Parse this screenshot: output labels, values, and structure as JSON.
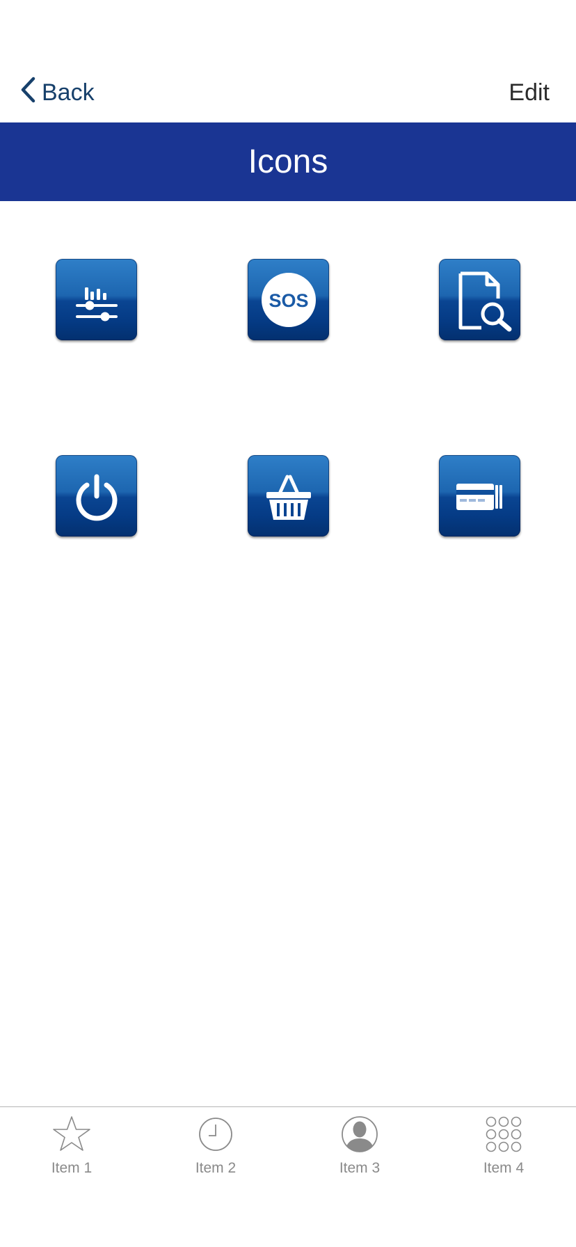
{
  "navbar": {
    "back_label": "Back",
    "edit_label": "Edit"
  },
  "header": {
    "title": "Icons"
  },
  "grid": {
    "icons": [
      {
        "name": "equalizer-icon"
      },
      {
        "name": "sos-icon",
        "text": "SOS"
      },
      {
        "name": "document-search-icon"
      },
      {
        "name": "power-icon"
      },
      {
        "name": "basket-icon"
      },
      {
        "name": "credit-card-icon"
      }
    ]
  },
  "tabbar": {
    "items": [
      {
        "label": "Item 1",
        "icon": "star-icon"
      },
      {
        "label": "Item 2",
        "icon": "clock-icon"
      },
      {
        "label": "Item 3",
        "icon": "person-icon"
      },
      {
        "label": "Item 4",
        "icon": "grid-dots-icon"
      }
    ]
  },
  "colors": {
    "title_bar": "#1a3593",
    "back_text": "#17406b",
    "tile_top": "#2f7fc8",
    "tile_bottom": "#03306f",
    "tab_label": "#8a8a8a"
  }
}
